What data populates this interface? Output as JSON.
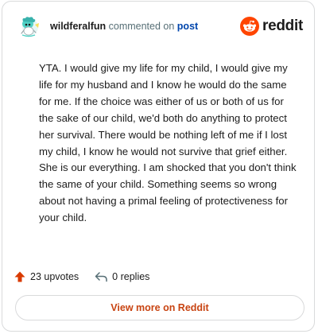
{
  "header": {
    "username": "wildferalfun",
    "verb": " commented on ",
    "post_link": "post",
    "brand": "reddit"
  },
  "comment": {
    "text": "YTA. I would give my life for my child, I would give my life for my husband and I know he would do the same for me. If the choice was either of us or both of us for the sake of our child, we'd both do anything to protect her survival. There would be nothing left of me if I lost my child, I know he would not survive that grief either. She is our everything. I am shocked that you don't think the same of your child. Something seems so wrong about not having a primal feeling of protectiveness for your child."
  },
  "stats": {
    "upvotes": "23 upvotes",
    "replies": "0 replies"
  },
  "actions": {
    "view_more": "View more on Reddit"
  },
  "colors": {
    "brand_orange": "#ff4500",
    "upvote_orange": "#d93a00",
    "link_blue": "#0045ac",
    "view_more_text": "#c84412",
    "avatar_teal": "#4fd1c5"
  },
  "icons": {
    "avatar": "snoo-avatar-icon",
    "logo": "reddit-logo-icon",
    "upvote": "upvote-arrow-icon",
    "reply": "reply-arrow-icon"
  }
}
